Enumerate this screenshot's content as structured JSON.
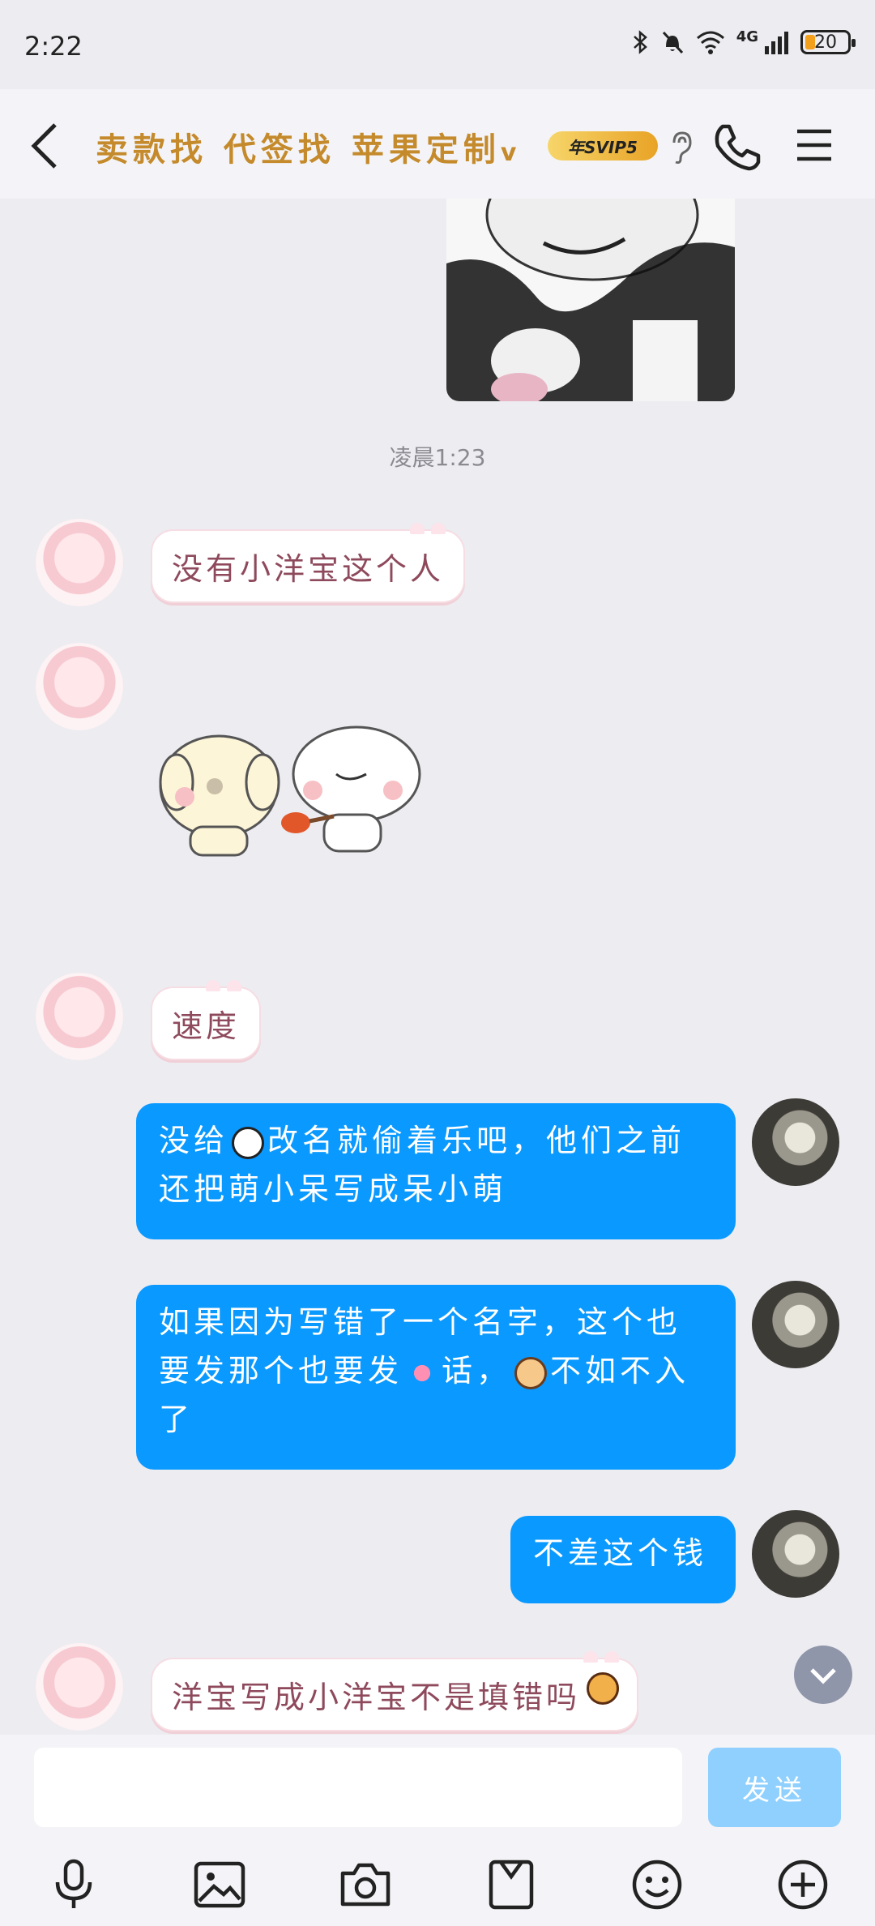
{
  "status": {
    "time": "2:22",
    "network": "4G",
    "battery": "20"
  },
  "header": {
    "title": "卖款找  代签找  苹果定制",
    "title_suffix": "v",
    "badge": "年SVIP5"
  },
  "messages": {
    "timestamp": "凌晨1:23",
    "m1": "没有小洋宝这个人",
    "m2": "速度",
    "r1_a": "没给",
    "r1_b": "改名就偷着乐吧，他们之前还把萌小呆写成呆小萌",
    "r2_a": "如果因为写错了一个名字，这个也要发那个也要发",
    "r2_b": "话，",
    "r2_c": "不如不入了",
    "r3": "不差这个钱",
    "m3": "洋宝写成小洋宝不是填错吗"
  },
  "input": {
    "placeholder": "",
    "send_label": "发送"
  },
  "icons": [
    "back-icon",
    "ear-icon",
    "phone-icon",
    "menu-icon",
    "voice-icon",
    "image-icon",
    "camera-icon",
    "folder-icon",
    "emoji-icon",
    "plus-icon",
    "chevron-down-icon"
  ],
  "colors": {
    "accent": "#0a99ff",
    "title_gold": "#c48a2b",
    "left_text": "#8e4a5c"
  }
}
